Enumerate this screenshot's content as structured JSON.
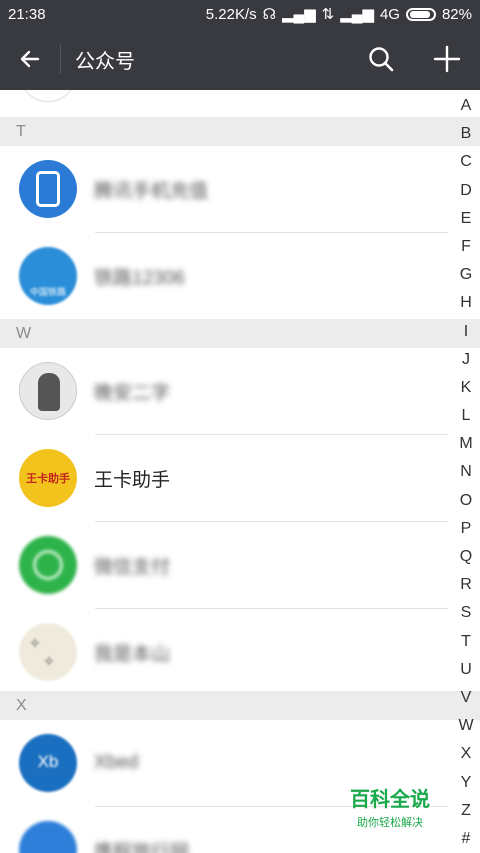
{
  "status": {
    "time": "21:38",
    "speed": "5.22K/s",
    "network": "4G",
    "battery": "82%"
  },
  "appbar": {
    "title": "公众号"
  },
  "sections": [
    {
      "letter": "T",
      "items": [
        {
          "name": "腾讯手机充值",
          "blurred": true,
          "avatar_color": "#2b7bd6"
        },
        {
          "name": "铁路12306",
          "blurred": true,
          "avatar_color": "#2a8fd8",
          "avatar_text": "中国铁路"
        }
      ]
    },
    {
      "letter": "W",
      "items": [
        {
          "name": "晚安二字",
          "blurred": true,
          "avatar_color": "#d9d9d9"
        },
        {
          "name": "王卡助手",
          "blurred": false,
          "avatar_color": "#f2c21d",
          "avatar_text": "王卡助手"
        },
        {
          "name": "微信支付",
          "blurred": true,
          "avatar_color": "#2eb34a"
        },
        {
          "name": "我是本山",
          "blurred": true,
          "avatar_color": "#efeadc"
        }
      ]
    },
    {
      "letter": "X",
      "items": [
        {
          "name": "Xbed",
          "blurred": true,
          "avatar_color": "#1b6fc0",
          "avatar_text": "Xb"
        },
        {
          "name": "携程旅行网",
          "blurred": true,
          "avatar_color": "#2d7fd9"
        }
      ]
    }
  ],
  "index_letters": [
    "A",
    "B",
    "C",
    "D",
    "E",
    "F",
    "G",
    "H",
    "I",
    "J",
    "K",
    "L",
    "M",
    "N",
    "O",
    "P",
    "Q",
    "R",
    "S",
    "T",
    "U",
    "V",
    "W",
    "X",
    "Y",
    "Z",
    "#"
  ],
  "watermark": {
    "title": "百科全说",
    "subtitle": "助你轻松解决"
  }
}
